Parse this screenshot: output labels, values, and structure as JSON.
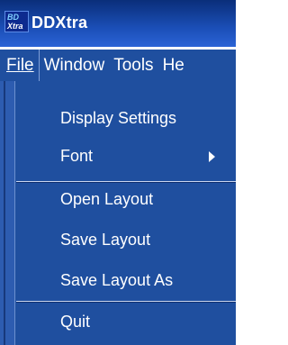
{
  "window": {
    "title": "DDXtra",
    "icon_text_top": "BD",
    "icon_text_bottom": "Xtra"
  },
  "menubar": {
    "items": [
      "File",
      "Window",
      "Tools",
      "He"
    ]
  },
  "file_menu": {
    "items": [
      {
        "label": "Display Settings"
      },
      {
        "label": "Font",
        "has_submenu": true
      },
      {
        "label": "Open Layout"
      },
      {
        "label": "Save Layout"
      },
      {
        "label": "Save Layout As"
      },
      {
        "label": "Quit"
      }
    ]
  },
  "colors": {
    "menu_bg": "#1f4f9f",
    "title_bg": "#1b4fb7",
    "text": "#ffffff"
  }
}
